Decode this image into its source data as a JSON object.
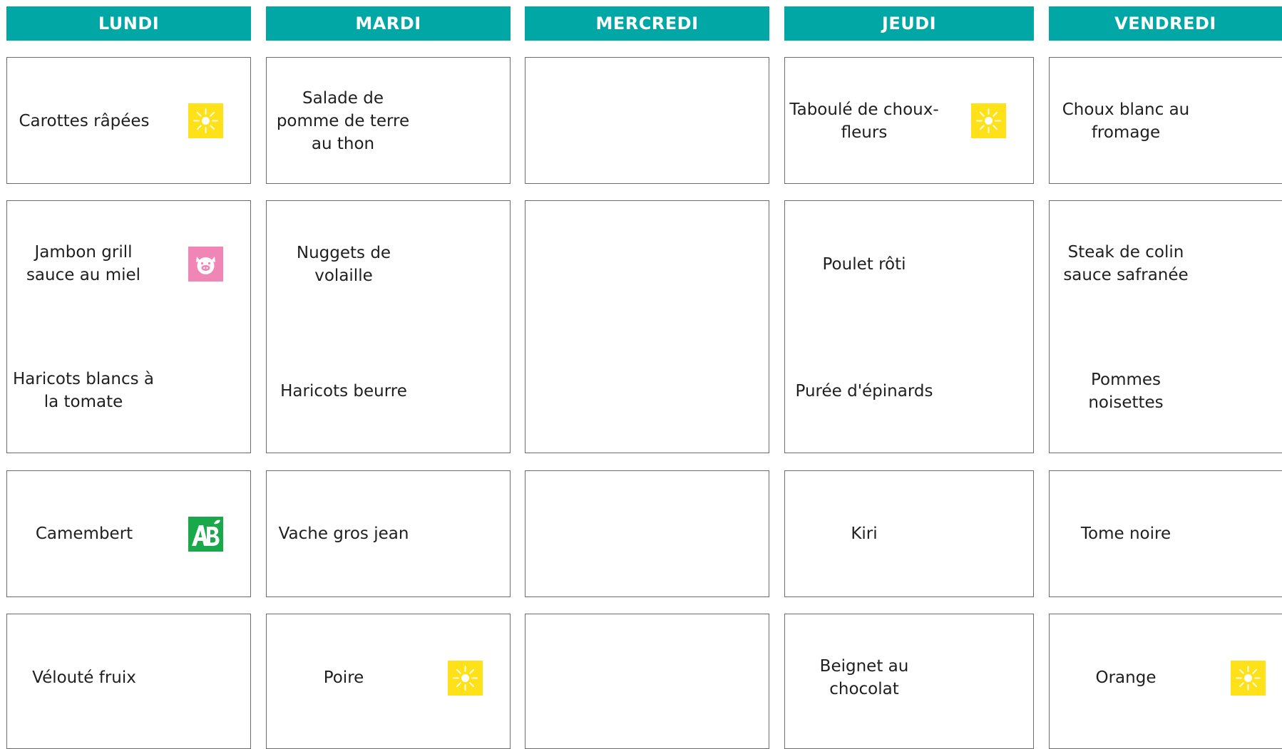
{
  "colors": {
    "header_bg": "#00a7a5",
    "sun_bg": "#ffe11a",
    "pig_bg": "#ef86b6",
    "bio_bg": "#19a84a"
  },
  "days": [
    "LUNDI",
    "MARDI",
    "MERCREDI",
    "JEUDI",
    "VENDREDI"
  ],
  "menu": {
    "lundi": {
      "entree": "Carottes râpées",
      "plat": "Jambon grill sauce au miel",
      "accompagnement": "Haricots blancs à la tomate",
      "fromage": "Camembert",
      "dessert": "Vélouté fruix"
    },
    "mardi": {
      "entree": "Salade de pomme de terre au thon",
      "plat": "Nuggets de volaille",
      "accompagnement": "Haricots beurre",
      "fromage": "Vache gros jean",
      "dessert": "Poire"
    },
    "jeudi": {
      "entree": "Taboulé de choux-fleurs",
      "plat": "Poulet rôti",
      "accompagnement": "Purée d'épinards",
      "fromage": "Kiri",
      "dessert": "Beignet au chocolat"
    },
    "vendredi": {
      "entree": "Choux blanc au fromage",
      "plat": "Steak de colin sauce safranée",
      "accompagnement": "Pommes noisettes",
      "fromage": "Tome noire",
      "dessert": "Orange"
    }
  },
  "icons": {
    "lundi_entree": "sun-icon",
    "lundi_plat": "pig-icon",
    "lundi_fromage": "organic-ab-icon",
    "mardi_dessert": "sun-icon",
    "jeudi_entree": "sun-icon",
    "vendredi_dessert": "sun-icon"
  }
}
